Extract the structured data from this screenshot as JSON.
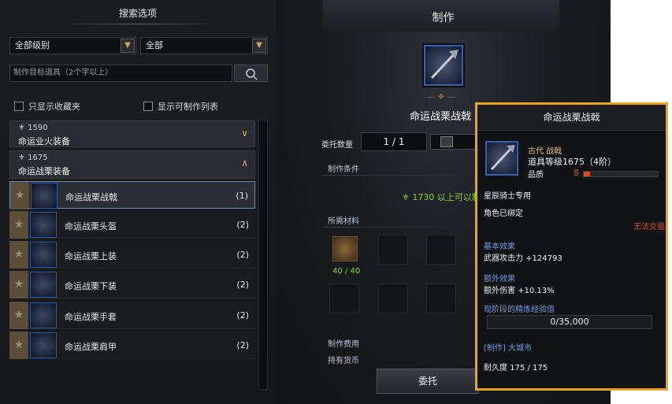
{
  "left": {
    "title": "搜索选项",
    "grade_filter": "全部级别",
    "type_filter": "全部",
    "search_placeholder": "制作目标道具（2个字以上）",
    "show_favorites": "只显示收藏夹",
    "show_craftable": "显示可制作列表",
    "groups": [
      {
        "level": "1590",
        "name": "命运业火装备",
        "expanded": false
      },
      {
        "level": "1675",
        "name": "命运战栗装备",
        "expanded": true
      }
    ],
    "items": [
      {
        "name": "命运战栗战戟",
        "count": "(1)",
        "selected": true
      },
      {
        "name": "命运战栗头盔",
        "count": "(2)",
        "selected": false
      },
      {
        "name": "命运战栗上装",
        "count": "(2)",
        "selected": false
      },
      {
        "name": "命运战栗下装",
        "count": "(2)",
        "selected": false
      },
      {
        "name": "命运战栗手套",
        "count": "(2)",
        "selected": false
      },
      {
        "name": "命运战栗肩甲",
        "count": "(2)",
        "selected": false
      }
    ]
  },
  "craft": {
    "title": "制作",
    "item_name": "命运战栗战戟",
    "quantity_label": "委托数量",
    "quantity_value": "1 / 1",
    "conditions_label": "制作条件",
    "condition_text": "1730 以上可以制",
    "materials_label": "所需材料",
    "material_count": "40 / 40",
    "cost_label": "制作费用",
    "currency_label": "持有货币",
    "commission_button": "委托"
  },
  "tooltip": {
    "name": "命运战栗战戟",
    "grade_type": "古代 战戟",
    "item_level": "道具等级1675（4阶）",
    "quality_label": "品质",
    "quality_value": "8",
    "quality_fraction": 0.08,
    "class_only": "星辰骑士专用",
    "bound": "角色已绑定",
    "untradable": "无法交易",
    "base_effect_label": "基本效果",
    "base_effect": "武器攻击力 +124793",
    "extra_effect_label": "额外效果",
    "extra_effect": "额外伤害 +10.13%",
    "xp_label": "现阶段的精炼经验值",
    "xp_value": "0/35,000",
    "craft_location": "[制作] 大城市",
    "durability": "耐久度 175 / 175"
  },
  "colors": {
    "accent_gold": "#f0a320",
    "green": "#7ed321",
    "blue_label": "#6f9be0",
    "red": "#e04a20"
  }
}
